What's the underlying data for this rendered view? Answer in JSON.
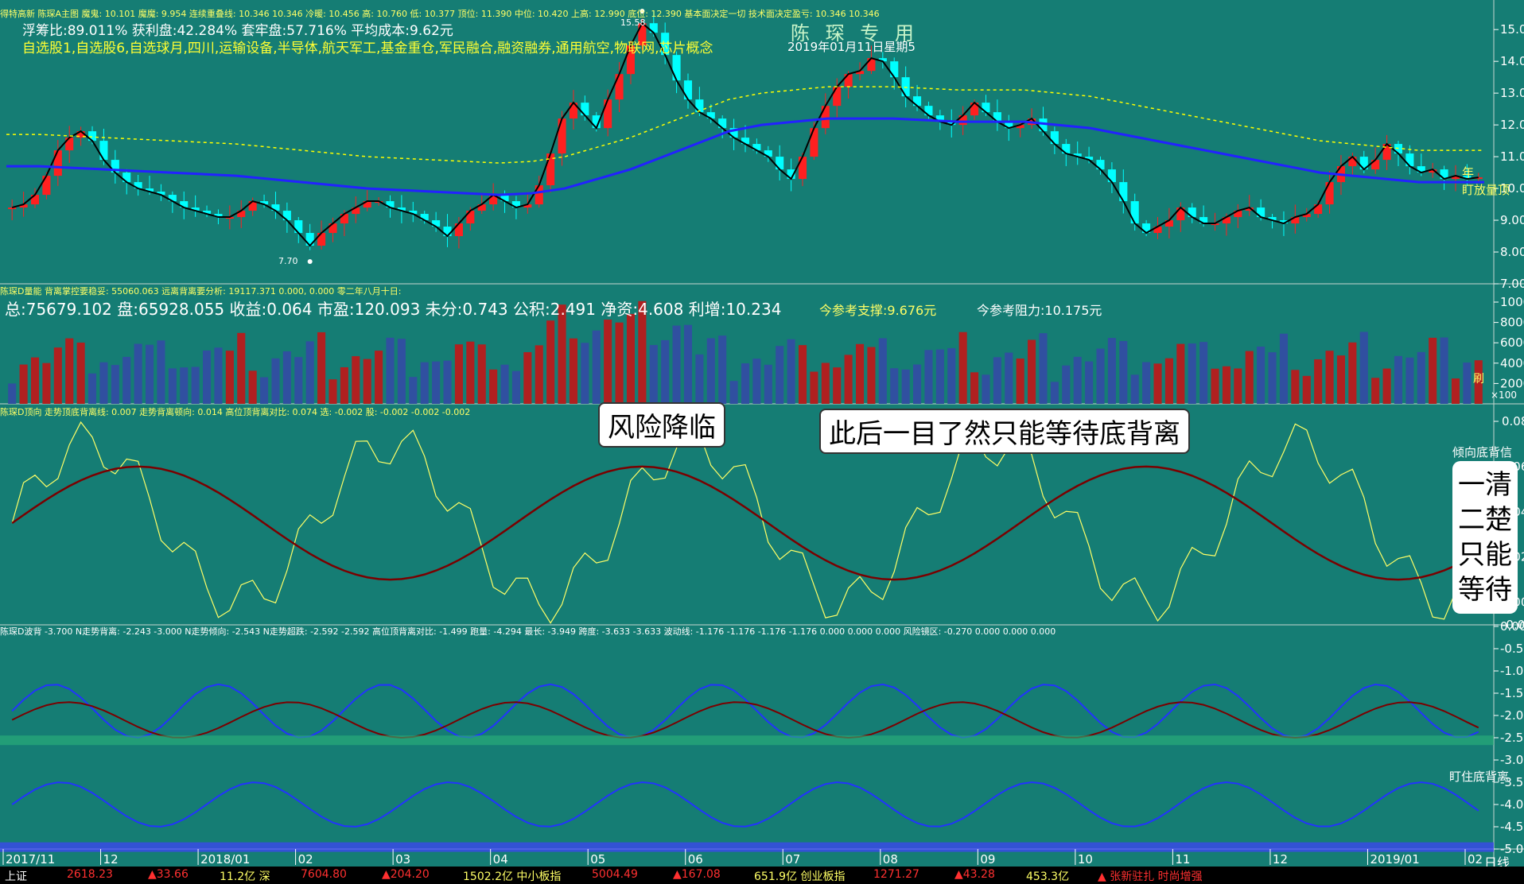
{
  "colors": {
    "background": "#157d74",
    "up": "#ff2020",
    "down": "#00ffff",
    "ma_long": "#2222ff",
    "ma_mid": "#ffff00",
    "ma_short": "#000000",
    "label_yellow": "#ffff00",
    "grid": "#b0d8d0"
  },
  "panels": [
    {
      "header": "得特高新  陈琛A主图 魔鬼: 10.101  魔魔: 9.954  连续重叠线: 10.346  10.346  冷暖: 10.456  高: 10.760  低: 10.377  顶位: 11.390  中位: 10.420  上高: 12.990  底位: 12.390  基本面决定一切  技术面决定盈亏: 10.346  10.346",
      "stats": "浮筹比:89.011%  获利盘:42.284%  套牢盘:57.716%  平均成本:9.62元",
      "sectors": "自选股1,自选股6,自选球月,四川,运输设备,半导体,航天军工,基金重仓,军民融合,融资融券,通用航空,物联网,芯片概念",
      "watermark": "陈 琛 专 用",
      "date": "2019年01月11日星期5",
      "high_label": "15.58",
      "low_label": "7.70",
      "right_label_1": "年",
      "right_label_2": "盯放量顶"
    },
    {
      "header": "陈琛D量能  背离掌控要稳妥: 55060.063  远离背离要分析: 19117.371  0.000, 0.000  零二年八月十日:",
      "fundamentals": "总:75679.102 盘:65928.055 收益:0.064 市盈:120.093 未分:0.743 公积:2.491 净资:4.608 利增:10.234",
      "support": "今参考支撑:9.676元",
      "resistance": "今参考阻力:10.175元",
      "right_label": "刷",
      "scale": "×100"
    },
    {
      "header": "陈琛D顶向  走势顶底背离线: 0.007  走势背离顿向: 0.014  高位顶背离对比: 0.074  选: -0.002  股: -0.002  -0.002  -0.002",
      "right_label": "倾向底背信"
    },
    {
      "header": "陈琛D波背  -3.700  N走势背离: -2.243  -3.000  N走势倾向: -2.543  N走势超跌: -2.592  -2.592  高位顶背离对比: -1.499  跑量: -4.294  最长: -3.949  跨度: -3.633  -3.633  波动线: -1.176  -1.176  -1.176  -1.176  0.000  0.000  0.000  风险镜区: -0.270  0.000  0.000  0.000",
      "right_label": "盯住底背离"
    }
  ],
  "annotations": {
    "risk": "风险降临",
    "wait": "此后一目了然只能等待底背离",
    "side": [
      "一清",
      "二楚",
      "只能",
      "等待"
    ]
  },
  "period": "日线",
  "axes": {
    "price_ticks": [
      "15.00",
      "14.00",
      "13.00",
      "12.00",
      "11.00",
      "10.00",
      "9.00",
      "8.00",
      "7.00"
    ],
    "volume_ticks": [
      "10000",
      "8000",
      "6000",
      "4000",
      "2000"
    ],
    "divergence_ticks": [
      "0.08",
      "0.06",
      "0.04",
      "0.02",
      "0.00",
      "-0.01"
    ],
    "wave_ticks": [
      "0.00",
      "-0.50",
      "-1.00",
      "-1.50",
      "-2.00",
      "-2.50",
      "-3.00",
      "-3.50",
      "-4.00",
      "-4.50",
      "-5.00"
    ],
    "date_labels": [
      "2017/11",
      "12",
      "2018/01",
      "02",
      "03",
      "04",
      "05",
      "06",
      "07",
      "08",
      "09",
      "10",
      "11",
      "12",
      "2019/01",
      "02"
    ]
  },
  "status_bar": [
    {
      "text": "上证",
      "color": "#ffffff"
    },
    {
      "text": "2618.23",
      "color": "#ff3030"
    },
    {
      "text": "▲33.66",
      "color": "#ff3030"
    },
    {
      "text": "11.2亿 深",
      "color": "#ffff66"
    },
    {
      "text": "7604.80",
      "color": "#ff3030"
    },
    {
      "text": "▲204.20",
      "color": "#ff3030"
    },
    {
      "text": "1502.2亿 中小板指",
      "color": "#ffff66"
    },
    {
      "text": "5004.49",
      "color": "#ff3030"
    },
    {
      "text": "▲167.08",
      "color": "#ff3030"
    },
    {
      "text": "651.9亿 创业板指",
      "color": "#ffff66"
    },
    {
      "text": "1271.27",
      "color": "#ff3030"
    },
    {
      "text": "▲43.28",
      "color": "#ff3030"
    },
    {
      "text": "453.3亿",
      "color": "#ffff66"
    },
    {
      "text": "▲ 张新驻扎 时尚增强",
      "color": "#ff3030"
    }
  ],
  "chart_data": [
    {
      "type": "candlestick",
      "panel": "price",
      "ylim": [
        7.0,
        15.58
      ],
      "high_marker": 15.58,
      "low_marker": 7.7,
      "close_path": [
        9.4,
        9.5,
        9.8,
        10.4,
        11.2,
        11.6,
        11.8,
        11.5,
        10.9,
        10.5,
        10.2,
        10.0,
        9.9,
        9.8,
        9.6,
        9.4,
        9.3,
        9.2,
        9.1,
        9.1,
        9.3,
        9.6,
        9.5,
        9.3,
        9.0,
        8.6,
        8.2,
        8.6,
        8.9,
        9.2,
        9.4,
        9.6,
        9.6,
        9.4,
        9.3,
        9.2,
        9.0,
        8.8,
        8.5,
        8.9,
        9.3,
        9.5,
        9.8,
        9.6,
        9.4,
        9.5,
        10.1,
        11.1,
        12.2,
        12.7,
        12.3,
        11.9,
        12.8,
        13.6,
        14.5,
        15.2,
        14.9,
        14.2,
        13.4,
        12.8,
        12.4,
        12.2,
        11.9,
        11.6,
        11.4,
        11.2,
        11.0,
        10.6,
        10.3,
        11.0,
        11.9,
        12.6,
        13.2,
        13.6,
        13.7,
        14.1,
        14.0,
        13.5,
        12.9,
        12.6,
        12.3,
        12.1,
        12.0,
        12.3,
        12.7,
        12.4,
        12.1,
        11.9,
        12.0,
        12.2,
        11.8,
        11.4,
        11.1,
        11.0,
        10.9,
        10.6,
        10.2,
        9.6,
        8.9,
        8.6,
        8.8,
        9.0,
        9.4,
        9.1,
        8.9,
        8.9,
        9.1,
        9.3,
        9.4,
        9.1,
        9.0,
        8.9,
        9.1,
        9.2,
        9.5,
        10.2,
        10.7,
        11.0,
        10.6,
        10.9,
        11.4,
        11.1,
        10.7,
        10.5,
        10.6,
        10.3,
        10.4,
        10.3,
        10.35
      ],
      "ma_long_path": [
        10.7,
        10.7,
        10.65,
        10.6,
        10.55,
        10.5,
        10.45,
        10.4,
        10.3,
        10.2,
        10.1,
        10.0,
        9.95,
        9.9,
        9.85,
        9.8,
        9.85,
        10.0,
        10.3,
        10.6,
        11.0,
        11.4,
        11.8,
        12.0,
        12.1,
        12.2,
        12.2,
        12.2,
        12.15,
        12.1,
        12.1,
        12.1,
        12.0,
        11.9,
        11.7,
        11.5,
        11.3,
        11.1,
        10.9,
        10.7,
        10.5,
        10.4,
        10.3,
        10.2,
        10.2,
        10.2
      ],
      "volume_max": 10000,
      "divergence_range": [
        -0.01,
        0.08
      ],
      "wave_range": [
        -5.0,
        0.0
      ]
    }
  ]
}
